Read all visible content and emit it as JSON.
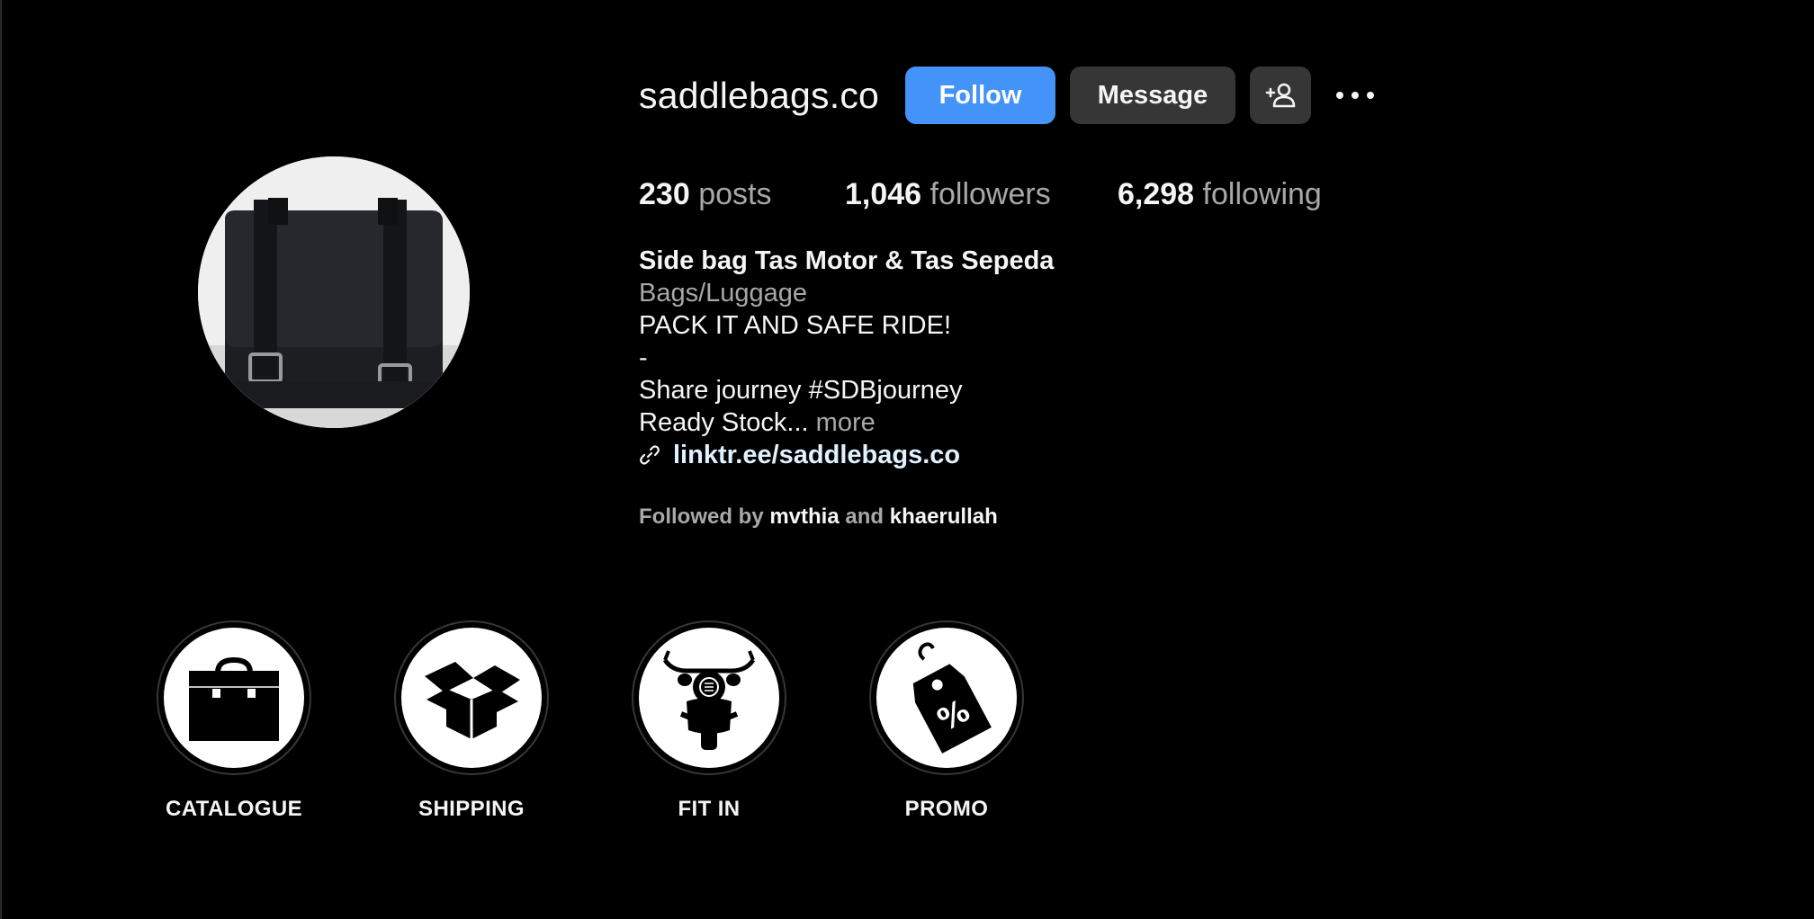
{
  "profile": {
    "username": "saddlebags.co",
    "avatar_alt": "profile-photo-black-saddle-bag"
  },
  "actions": {
    "follow_label": "Follow",
    "message_label": "Message",
    "add_user_icon": "person-add-icon",
    "more_icon": "more-horizontal-icon"
  },
  "stats": {
    "posts": {
      "count": "230",
      "label": "posts"
    },
    "followers": {
      "count": "1,046",
      "label": "followers"
    },
    "following": {
      "count": "6,298",
      "label": "following"
    }
  },
  "bio": {
    "full_name": "Side bag Tas Motor & Tas Sepeda",
    "category": "Bags/Luggage",
    "lines": [
      "PACK IT AND SAFE RIDE!",
      "-",
      "Share journey #SDBjourney"
    ],
    "truncated_line": "Ready Stock...",
    "more_label": "more",
    "link_icon": "link-icon",
    "link": "linktr.ee/saddlebags.co"
  },
  "followed_by": {
    "prefix": "Followed by",
    "user1": "mvthia",
    "joiner": "and",
    "user2": "khaerullah"
  },
  "highlights": [
    {
      "label": "CATALOGUE",
      "icon": "briefcase-icon"
    },
    {
      "label": "SHIPPING",
      "icon": "open-box-icon"
    },
    {
      "label": "FIT IN",
      "icon": "motorcycle-icon"
    },
    {
      "label": "PROMO",
      "icon": "discount-tag-icon"
    }
  ],
  "colors": {
    "background": "#000000",
    "follow_button": "#4493f8",
    "secondary_button": "#363636",
    "muted_text": "#a8a8a8",
    "link_text": "#e0f1ff"
  }
}
